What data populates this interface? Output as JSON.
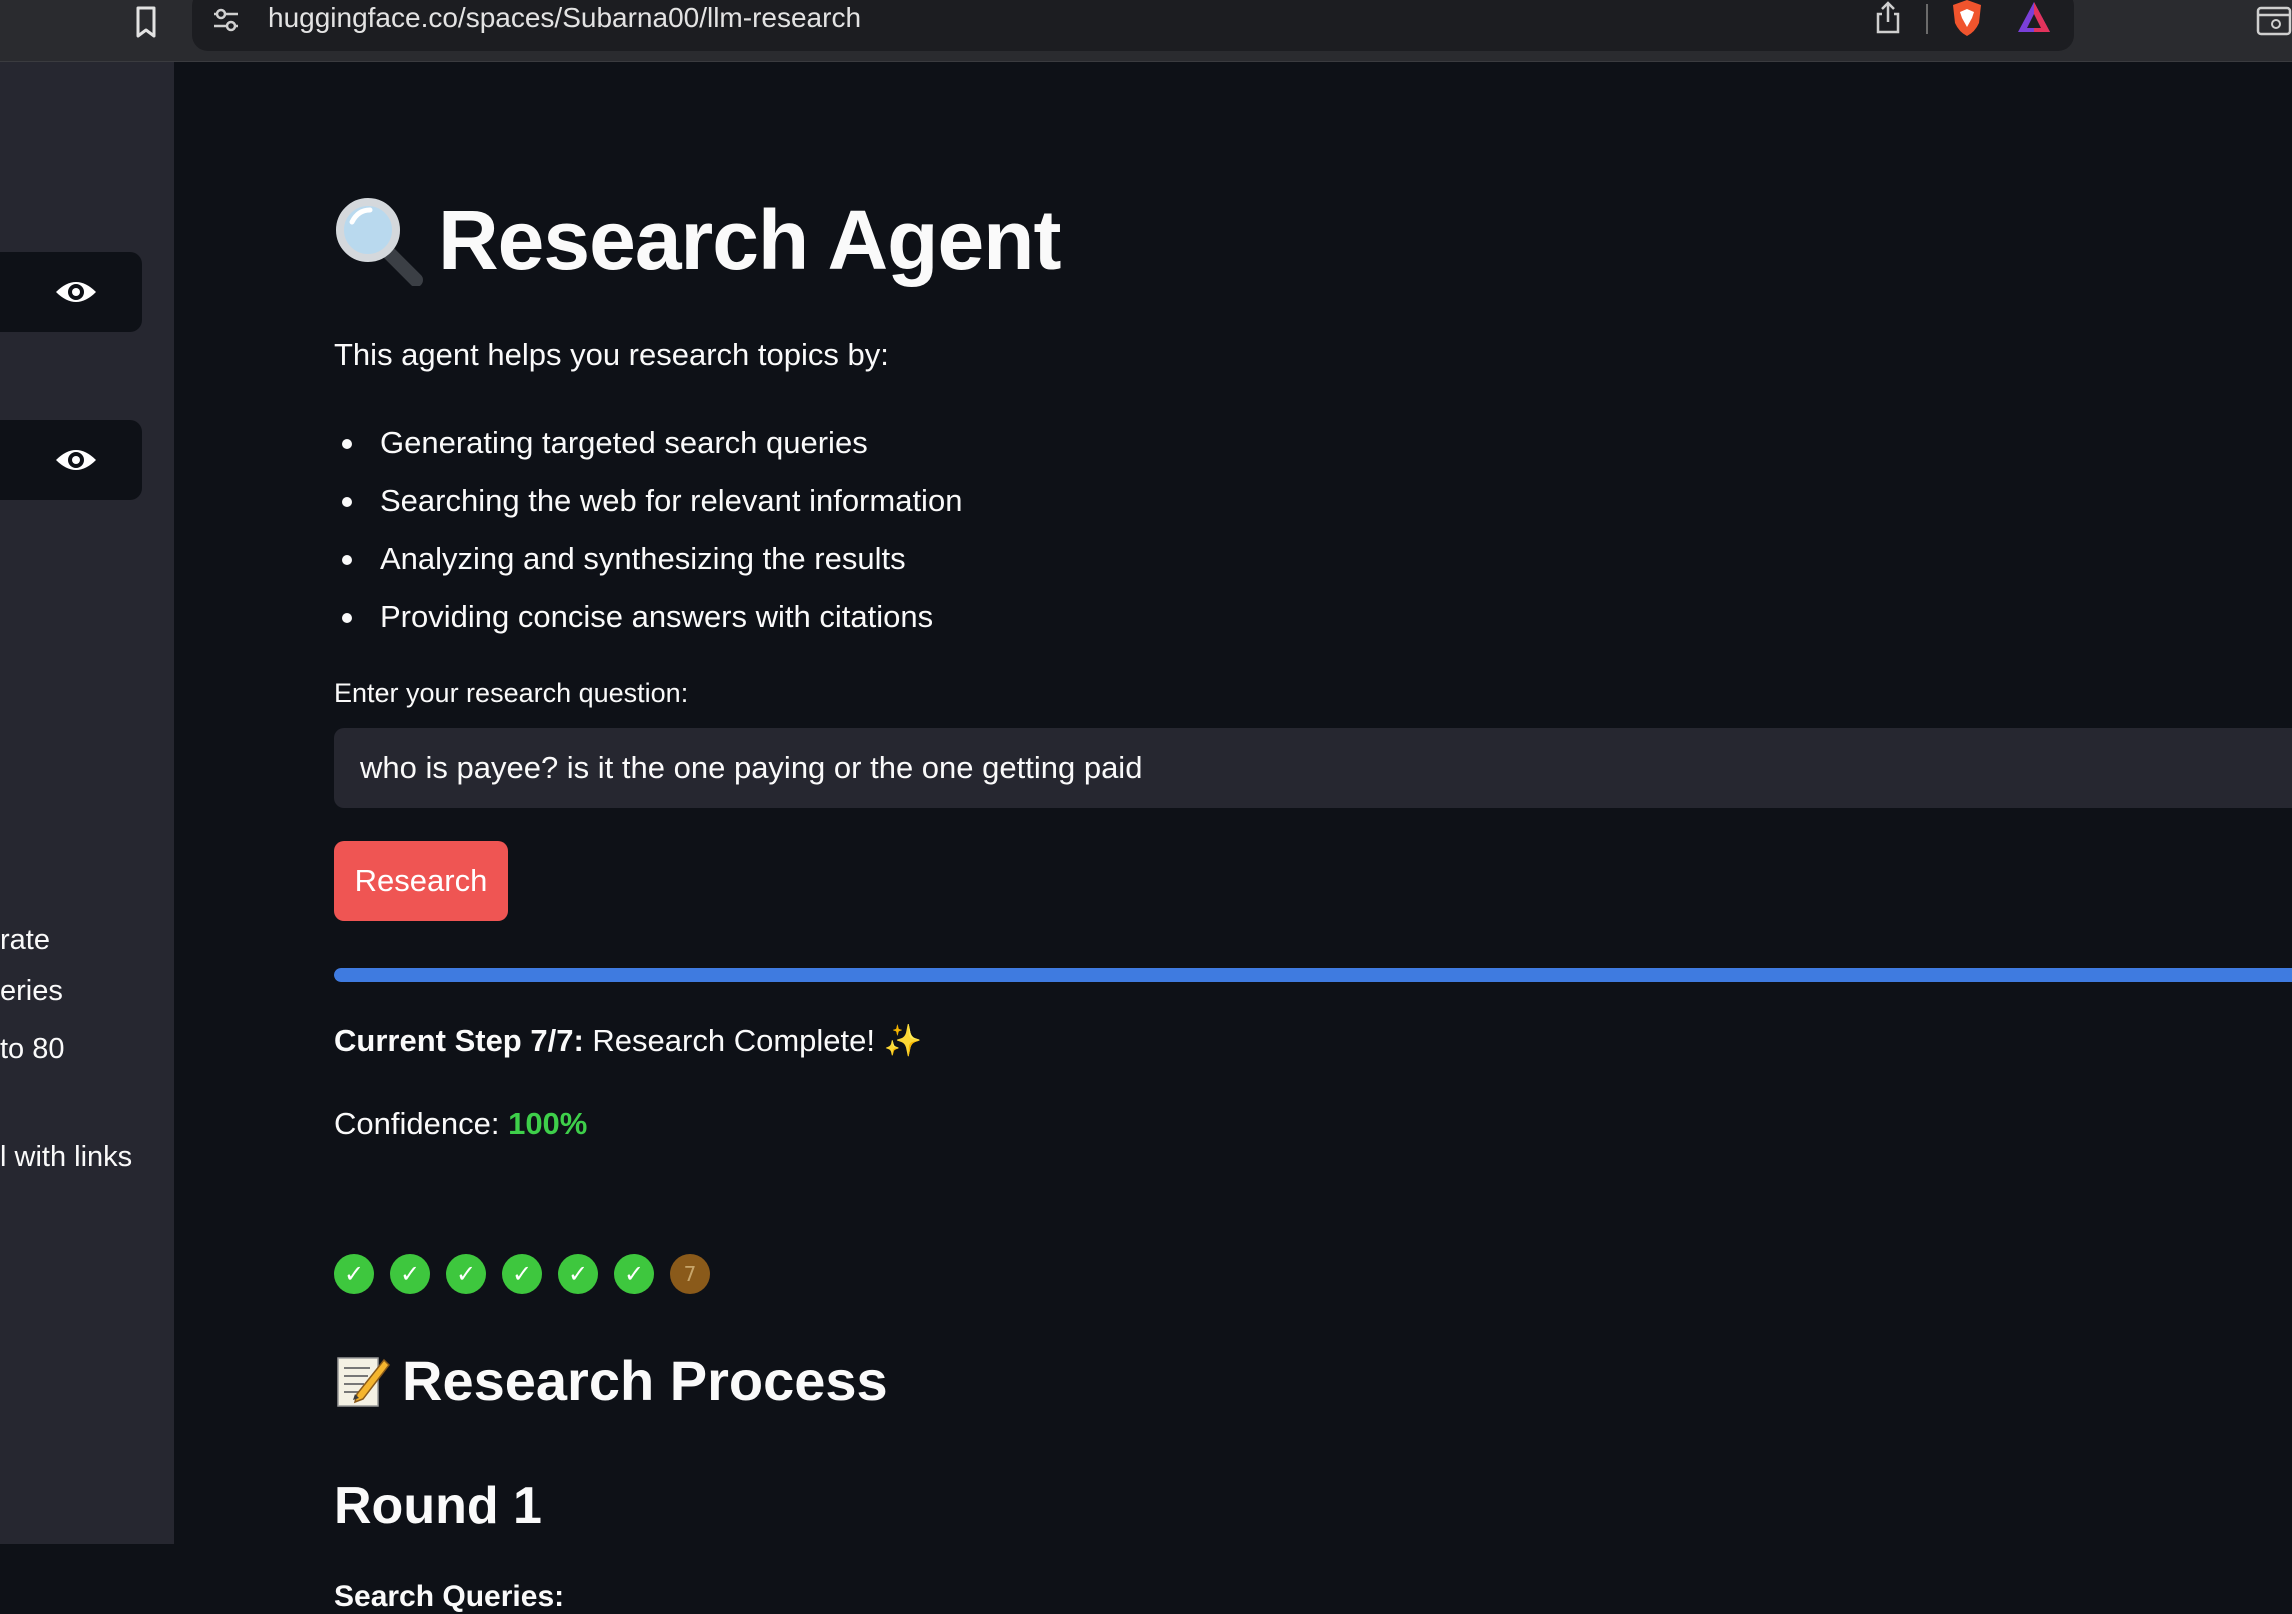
{
  "browser": {
    "url": "huggingface.co/spaces/Subarna00/llm-research"
  },
  "sidebar": {
    "text_fragments": [
      "rate",
      "eries",
      "to 80",
      "l with links"
    ]
  },
  "main": {
    "title": "Research Agent",
    "intro": "This agent helps you research topics by:",
    "bullets": [
      "Generating targeted search queries",
      "Searching the web for relevant information",
      "Analyzing and synthesizing the results",
      "Providing concise answers with citations"
    ],
    "question_label": "Enter your research question:",
    "question_value": "who is payee? is it the one paying or the one getting paid",
    "research_button": "Research",
    "progress_fraction": 1.0,
    "step_label": "Current Step 7/7:",
    "step_text": "Research Complete! ✨",
    "confidence_label": "Confidence:",
    "confidence_value": "100%",
    "step_indicators": [
      "✓",
      "✓",
      "✓",
      "✓",
      "✓",
      "✓",
      "7"
    ],
    "process_heading": "Research Process",
    "round_heading": "Round 1",
    "queries_heading": "Search Queries:"
  },
  "colors": {
    "background": "#0e1117",
    "sidebar": "#262730",
    "button": "#ef5553",
    "progress": "#3f7be0",
    "confidence": "#3ecf4a"
  }
}
